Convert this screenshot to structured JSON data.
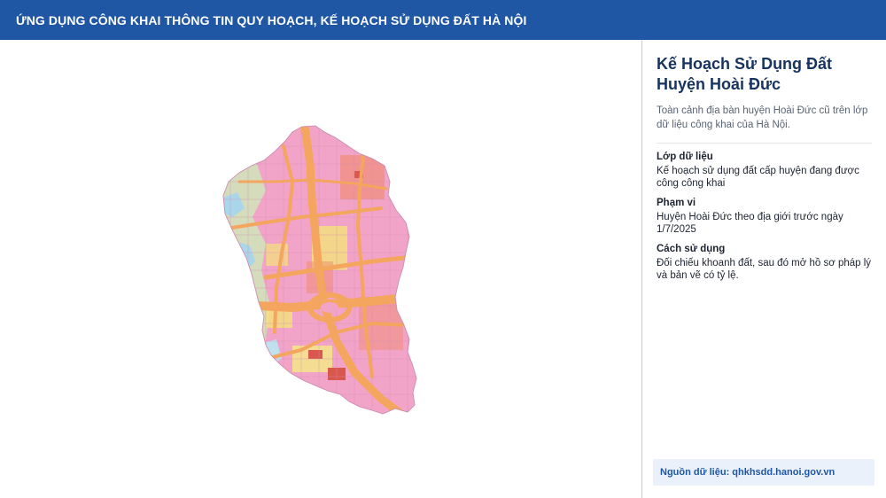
{
  "header": {
    "title": "ỨNG DỤNG CÔNG KHAI THÔNG TIN QUY HOẠCH, KẾ HOẠCH SỬ DỤNG ĐẤT HÀ NỘI"
  },
  "panel": {
    "title_line1": "Kế Hoạch Sử Dụng Đất",
    "title_line2": "Huyện Hoài Đức",
    "description": "Toàn cảnh địa bàn huyện Hoài Đức cũ trên lớp dữ liệu công khai của Hà Nội.",
    "sections": [
      {
        "label": "Lớp dữ liệu",
        "value": "Kế hoạch sử dụng đất cấp huyện đang được công công khai"
      },
      {
        "label": "Phạm vi",
        "value": "Huyện Hoài Đức theo địa giới trước ngày 1/7/2025"
      },
      {
        "label": "Cách sử dụng",
        "value": "Đối chiếu khoanh đất, sau đó mở hồ sơ pháp lý và bản vẽ có tỷ lệ."
      }
    ],
    "source": "Nguồn dữ liệu: qhkhsdd.hanoi.gov.vn"
  },
  "colors": {
    "header_bg": "#1f57a5",
    "title_text": "#17335f",
    "residential_pink": "#f2a4c8",
    "road_orange": "#f4a55e",
    "commercial_salmon": "#f08a6c",
    "public_yellow": "#f4e27a",
    "water_blue": "#a9d6ea",
    "agri_green": "#cde6b4"
  }
}
